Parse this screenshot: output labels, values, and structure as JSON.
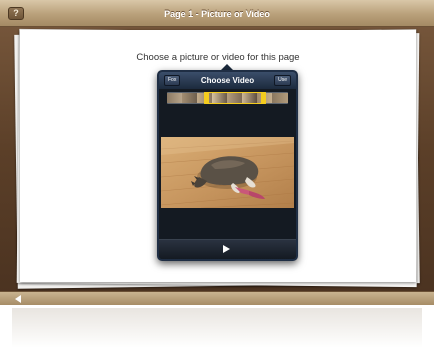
{
  "window": {
    "title": "Page 1 - Picture or Video",
    "help_label": "?"
  },
  "page": {
    "prompt": "Choose a picture or video for this page"
  },
  "popover": {
    "title": "Choose Video",
    "left_button": "Fox",
    "right_button": "Use"
  },
  "icons": {
    "help": "question-mark-icon",
    "prev": "left-arrow-icon",
    "play": "play-icon"
  },
  "colors": {
    "frame_wood": "#5b3f28",
    "title_bar": "#b9a07a",
    "popover_nav": "#1c2a3d",
    "scrubber_selection": "#f4cc1e"
  }
}
